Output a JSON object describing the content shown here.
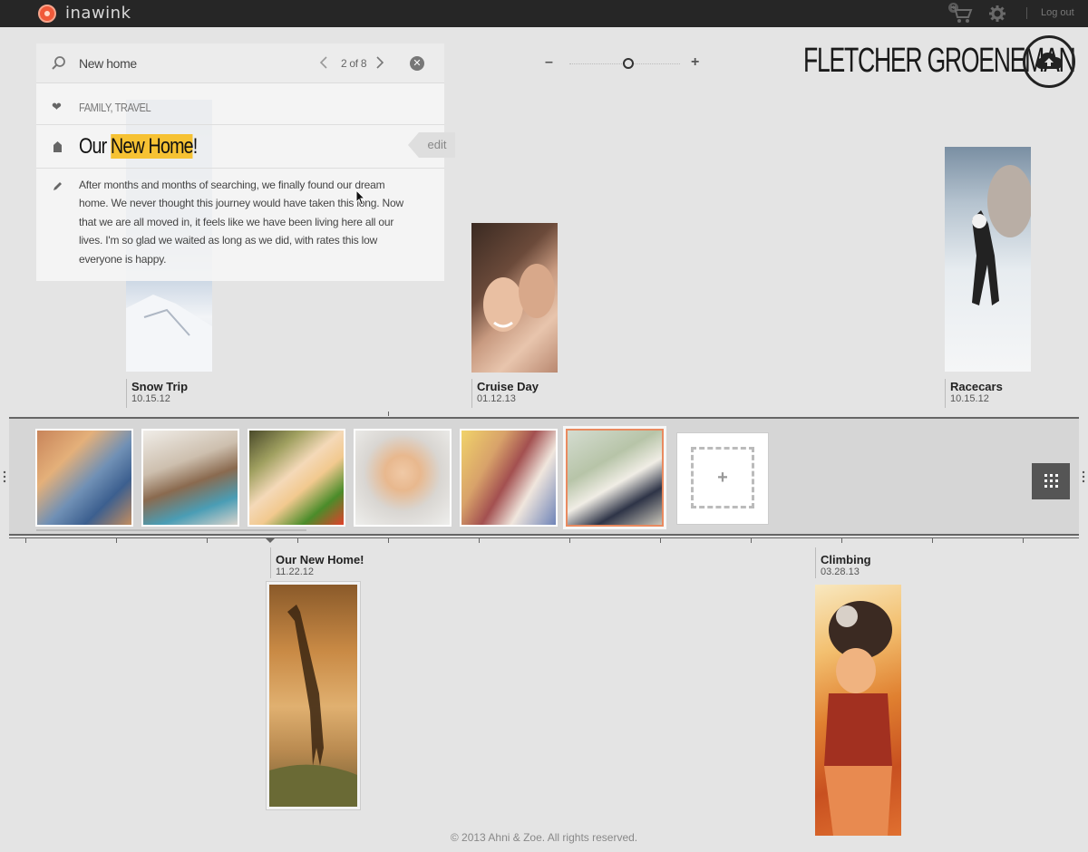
{
  "app": {
    "name": "inawink"
  },
  "topbar": {
    "cart_count": "0",
    "logout_label": "Log out"
  },
  "search": {
    "query": "New home",
    "placeholder": "",
    "result_count": "2 of 8"
  },
  "story": {
    "tags": "FAMILY, TRAVEL",
    "title_before": "Our ",
    "title_highlight": "New Home",
    "title_after": "!",
    "edit_label": "edit",
    "body": "After months and months of searching, we finally found our dream home. We never thought this journey would have taken this long. Now that we are all moved in, it feels like we have been living here all our lives. I'm so glad we waited as long as we did, with rates this low everyone is happy."
  },
  "profile": {
    "name": "FLETCHER GROENEMAN"
  },
  "timeline_top": [
    {
      "label": "Snow Trip",
      "date": "10.15.12"
    },
    {
      "label": "Cruise Day",
      "date": "01.12.13"
    },
    {
      "label": "Racecars",
      "date": "10.15.12"
    }
  ],
  "timeline_bottom": [
    {
      "label": "Our New Home!",
      "date": "11.22.12"
    },
    {
      "label": "Climbing",
      "date": "03.28.13"
    }
  ],
  "filmstrip": {
    "thumbs": [
      {
        "icon": "photo-baby-crawling-icon"
      },
      {
        "icon": "photo-kitchen-mom-child-icon"
      },
      {
        "icon": "photo-woman-smiling-icon"
      },
      {
        "icon": "photo-toddler-thinking-icon"
      },
      {
        "icon": "photo-father-son-icon"
      },
      {
        "icon": "photo-baby-pillows-icon"
      }
    ],
    "add_label": "+"
  },
  "footer": {
    "copyright": "© 2013 Ahni & Zoe. All rights reserved."
  },
  "colors": {
    "accent": "#f6c233",
    "selected_border": "#e98a60",
    "topbar": "#262626",
    "logo": "#f05a3a"
  }
}
